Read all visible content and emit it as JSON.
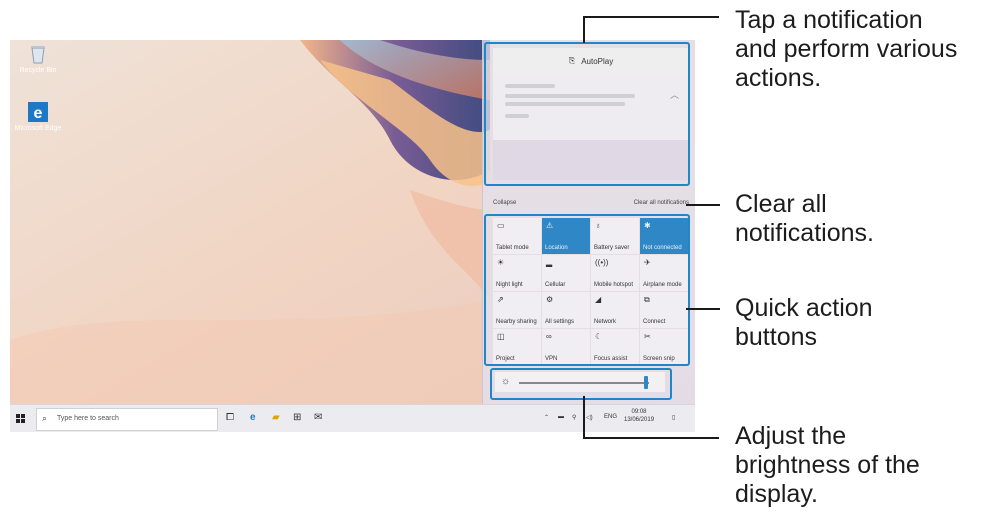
{
  "desktop": {
    "icons": [
      {
        "name": "recycle-bin",
        "label": "Recycle Bin"
      },
      {
        "name": "microsoft-edge",
        "label": "Microsoft Edge"
      }
    ]
  },
  "action_center": {
    "notification_app": "AutoPlay",
    "collapse_label": "Collapse",
    "clear_all_label": "Clear all notifications",
    "tiles": [
      {
        "label": "Tablet mode",
        "icon": "tablet-mode-icon",
        "glyph": "▭",
        "active": false
      },
      {
        "label": "Location",
        "icon": "location-icon",
        "glyph": "⚠",
        "active": true
      },
      {
        "label": "Battery saver",
        "icon": "battery-saver-icon",
        "glyph": "♁",
        "active": false
      },
      {
        "label": "Not connected",
        "icon": "bluetooth-icon",
        "glyph": "✱",
        "active": true
      },
      {
        "label": "Night light",
        "icon": "night-light-icon",
        "glyph": "☀",
        "active": false
      },
      {
        "label": "Cellular",
        "icon": "cellular-icon",
        "glyph": "▂",
        "active": false
      },
      {
        "label": "Mobile hotspot",
        "icon": "mobile-hotspot-icon",
        "glyph": "((•))",
        "active": false
      },
      {
        "label": "Airplane mode",
        "icon": "airplane-mode-icon",
        "glyph": "✈",
        "active": false
      },
      {
        "label": "Nearby sharing",
        "icon": "nearby-sharing-icon",
        "glyph": "⇗",
        "active": false
      },
      {
        "label": "All settings",
        "icon": "settings-gear-icon",
        "glyph": "⚙",
        "active": false
      },
      {
        "label": "Network",
        "icon": "network-icon",
        "glyph": "◢",
        "active": false
      },
      {
        "label": "Connect",
        "icon": "connect-icon",
        "glyph": "⧉",
        "active": false
      },
      {
        "label": "Project",
        "icon": "project-icon",
        "glyph": "◫",
        "active": false
      },
      {
        "label": "VPN",
        "icon": "vpn-icon",
        "glyph": "∞",
        "active": false
      },
      {
        "label": "Focus assist",
        "icon": "focus-assist-icon",
        "glyph": "☾",
        "active": false
      },
      {
        "label": "Screen snip",
        "icon": "screen-snip-icon",
        "glyph": "✂",
        "active": false
      }
    ],
    "brightness_level": 0.98
  },
  "taskbar": {
    "search_placeholder": "Type here to search",
    "language": "ENG",
    "time": "09:08",
    "date": "13/06/2019"
  },
  "callouts": {
    "notification": [
      "Tap a notification",
      "and perform various",
      "actions."
    ],
    "clear_all": [
      "Clear all",
      "notifications."
    ],
    "quick_action": [
      "Quick action",
      "buttons"
    ],
    "brightness": [
      "Adjust the",
      "brightness of the",
      "display."
    ]
  },
  "colors": {
    "highlight": "#1f86c8",
    "tile_active": "#2f87c5"
  }
}
